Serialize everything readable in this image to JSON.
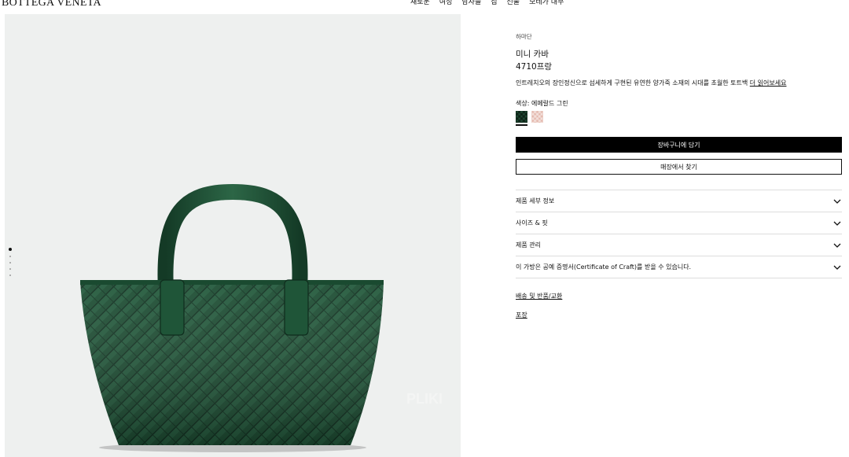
{
  "header": {
    "logo": "BOTTEGA VENETA",
    "nav": [
      "새로운",
      "여성",
      "남자들",
      "집",
      "선물",
      "보테가 내부"
    ]
  },
  "gallery": {
    "image_alt": "미니 카바 - 에메랄드 그린 인트레치아토 토트백",
    "watermark": "PLIKI",
    "slide_count": 5,
    "active_slide": 1
  },
  "product": {
    "breadcrumb": "하마단",
    "name": "미니 카바",
    "price": "4710프랑",
    "description": "인트레치오의 장인정신으로 섬세하게 구현된 유연한 양가죽 소재의 시대를 초월한 토트백",
    "read_more": "더 읽어보세요",
    "color_label": "색상: 에메랄드 그린",
    "colors": [
      {
        "name": "에메랄드 그린",
        "hex": "#1f4a33"
      },
      {
        "name": "pink",
        "hex": "#e4b8ad"
      }
    ],
    "add_to_cart": "장바구니에 담기",
    "find_in_store": "매장에서 찾기",
    "accordion": [
      "제품 세부 정보",
      "사이즈 & 핏",
      "제품 관리",
      "이 가방은 공예 증명서(Certificate of Craft)를 받을 수 있습니다."
    ],
    "shipping_link": "배송 및 반품/교환",
    "packaging_link": "포장"
  }
}
